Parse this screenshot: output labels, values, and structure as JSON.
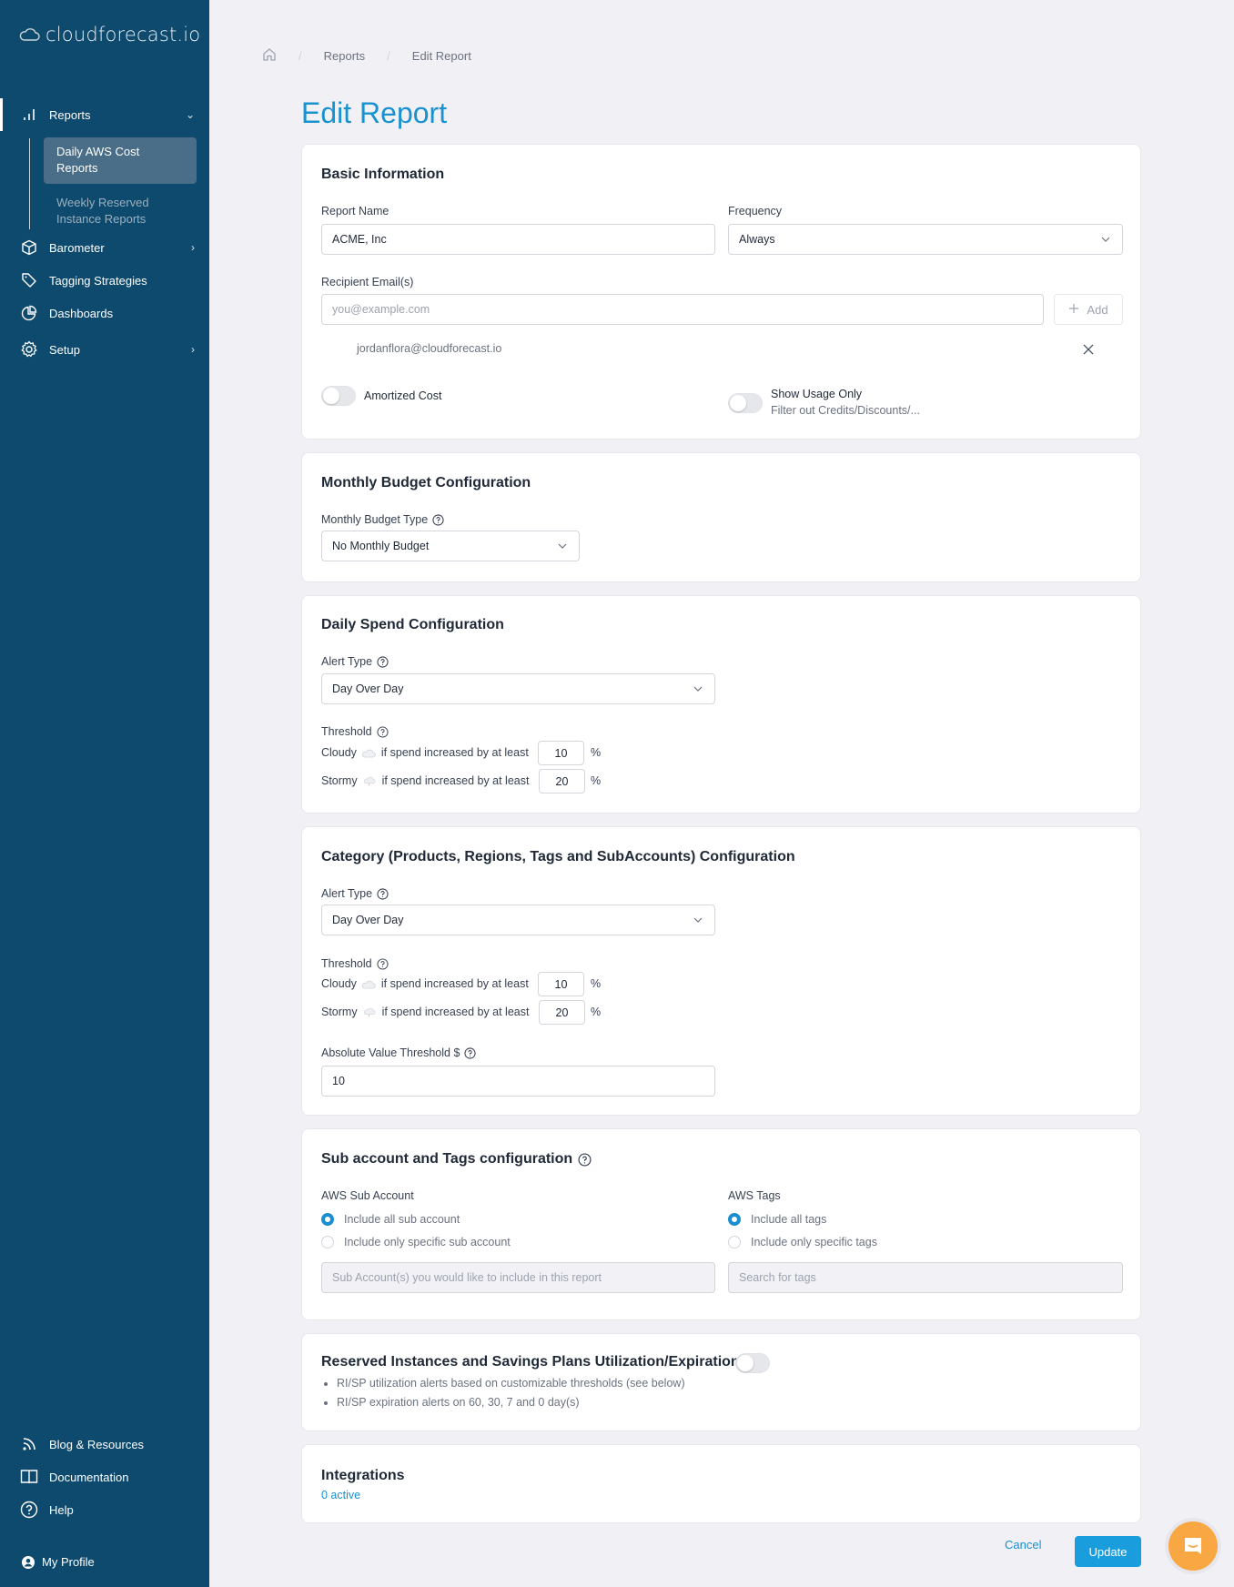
{
  "app": {
    "logo_text": "cloudforecast.io"
  },
  "sidebar": {
    "items": [
      {
        "label": "Reports",
        "icon": "bar-chart-icon",
        "expanded": true
      },
      {
        "label": "Barometer",
        "icon": "cube-icon"
      },
      {
        "label": "Tagging Strategies",
        "icon": "tag-icon"
      },
      {
        "label": "Dashboards",
        "icon": "pie-chart-icon"
      },
      {
        "label": "Setup",
        "icon": "gear-icon"
      }
    ],
    "sub_items": [
      {
        "label": "Daily AWS Cost Reports",
        "active": true
      },
      {
        "label": "Weekly Reserved Instance Reports",
        "active": false
      }
    ],
    "bottom_items": [
      {
        "label": "Blog & Resources",
        "icon": "rss-icon"
      },
      {
        "label": "Documentation",
        "icon": "book-icon"
      },
      {
        "label": "Help",
        "icon": "help-circle-icon"
      }
    ],
    "profile_label": "My Profile"
  },
  "breadcrumb": {
    "items": [
      "Reports",
      "Edit Report"
    ]
  },
  "page": {
    "title": "Edit Report"
  },
  "basic_info": {
    "title": "Basic Information",
    "report_name_label": "Report Name",
    "report_name_value": "ACME, Inc",
    "frequency_label": "Frequency",
    "frequency_value": "Always",
    "recipients_label": "Recipient Email(s)",
    "recipients_placeholder": "you@example.com",
    "add_label": "Add",
    "recipients": [
      "jordanflora@cloudforecast.io"
    ],
    "amortized_label": "Amortized Cost",
    "amortized_on": false,
    "usage_only_label": "Show Usage Only",
    "usage_only_desc": "Filter out Credits/Discounts/...",
    "usage_only_on": false
  },
  "monthly_budget": {
    "title": "Monthly Budget Configuration",
    "type_label": "Monthly Budget Type",
    "type_value": "No Monthly Budget"
  },
  "daily_spend": {
    "title": "Daily Spend Configuration",
    "alert_type_label": "Alert Type",
    "alert_type_value": "Day Over Day",
    "threshold_label": "Threshold",
    "cloudy_label": "Cloudy",
    "stormy_label": "Stormy",
    "condition_text": "if spend increased by at least",
    "cloudy_value": "10",
    "stormy_value": "20",
    "unit": "%"
  },
  "category": {
    "title": "Category (Products, Regions, Tags and SubAccounts) Configuration",
    "alert_type_label": "Alert Type",
    "alert_type_value": "Day Over Day",
    "threshold_label": "Threshold",
    "cloudy_label": "Cloudy",
    "stormy_label": "Stormy",
    "condition_text": "if spend increased by at least",
    "cloudy_value": "10",
    "stormy_value": "20",
    "unit": "%",
    "absolute_label": "Absolute Value Threshold $",
    "absolute_value": "10"
  },
  "subaccount_tags": {
    "title": "Sub account and Tags configuration",
    "sub_account_label": "AWS Sub Account",
    "sub_account_options": [
      "Include all sub account",
      "Include only specific sub account"
    ],
    "sub_account_selected": 0,
    "sub_account_placeholder": "Sub Account(s) you would like to include in this report",
    "tags_label": "AWS Tags",
    "tags_options": [
      "Include all tags",
      "Include only specific tags"
    ],
    "tags_selected": 0,
    "tags_placeholder": "Search for tags"
  },
  "ri_sp": {
    "title": "Reserved Instances and Savings Plans Utilization/Expiration",
    "enabled": false,
    "bullets": [
      "RI/SP utilization alerts based on customizable thresholds (see below)",
      "RI/SP expiration alerts on 60, 30, 7 and 0 day(s)"
    ]
  },
  "integrations": {
    "title": "Integrations",
    "active_text": "0 active"
  },
  "actions": {
    "cancel_label": "Cancel",
    "update_label": "Update"
  },
  "colors": {
    "sidebar_bg": "#0d4a6e",
    "accent": "#1a92d0",
    "update_button": "#1a9ddd",
    "chat_button": "#f8a742"
  }
}
